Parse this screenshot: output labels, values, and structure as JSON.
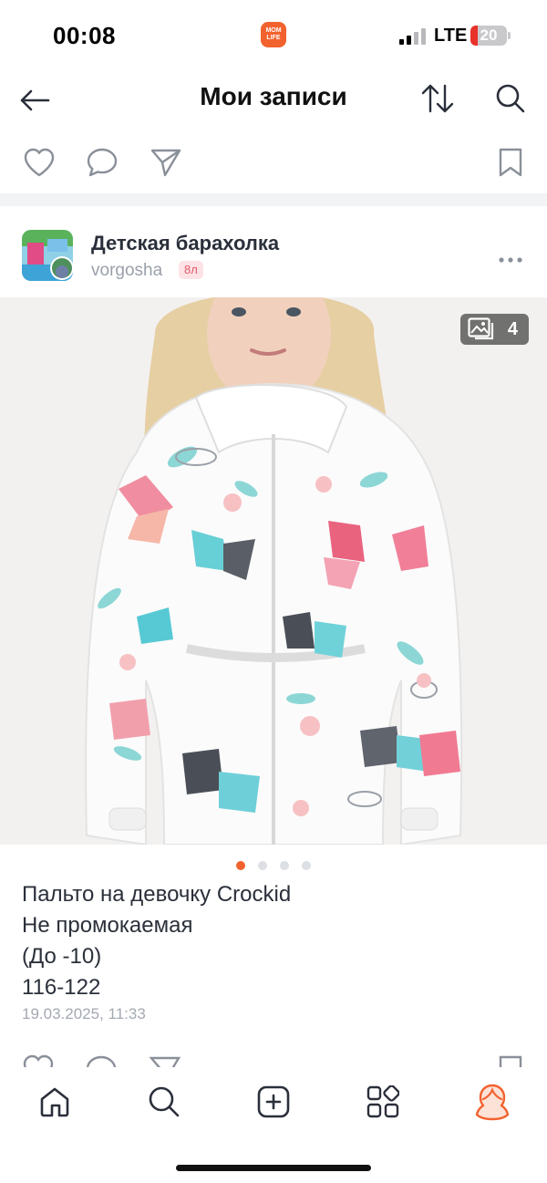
{
  "status_bar": {
    "time": "00:08",
    "app_badge": "MOM LIFE",
    "network": "LTE",
    "battery_level": "20",
    "battery_fraction": 0.2
  },
  "header": {
    "title": "Мои записи",
    "back_icon": "arrow-left-icon",
    "sort_icon": "sort-arrows-icon",
    "search_icon": "search-icon"
  },
  "post": {
    "group_name": "Детская барахолка",
    "author": "vorgosha",
    "author_level": "8л",
    "photo_count": "4",
    "photo_description_icon": "photo-gallery-icon",
    "carousel": {
      "total": 4,
      "active_index": 0
    },
    "caption_lines": [
      "Пальто на девочку Crockid",
      "Не промокаемая",
      "(До -10)",
      "116-122"
    ],
    "date": "19.03.2025, 11:33"
  },
  "actions": {
    "like_icon": "heart-icon",
    "comment_icon": "comment-bubble-icon",
    "share_icon": "send-icon",
    "bookmark_icon": "bookmark-icon",
    "more_icon": "more-dots-icon"
  },
  "tab_bar": {
    "items": [
      {
        "name": "home",
        "icon": "home-icon"
      },
      {
        "name": "search",
        "icon": "search-icon"
      },
      {
        "name": "create",
        "icon": "plus-square-icon"
      },
      {
        "name": "services",
        "icon": "apps-grid-icon"
      },
      {
        "name": "profile",
        "icon": "profile-avatar-icon",
        "active": true
      }
    ]
  },
  "colors": {
    "accent": "#f2622e",
    "text": "#2b303a",
    "muted": "#a4a9b1"
  }
}
